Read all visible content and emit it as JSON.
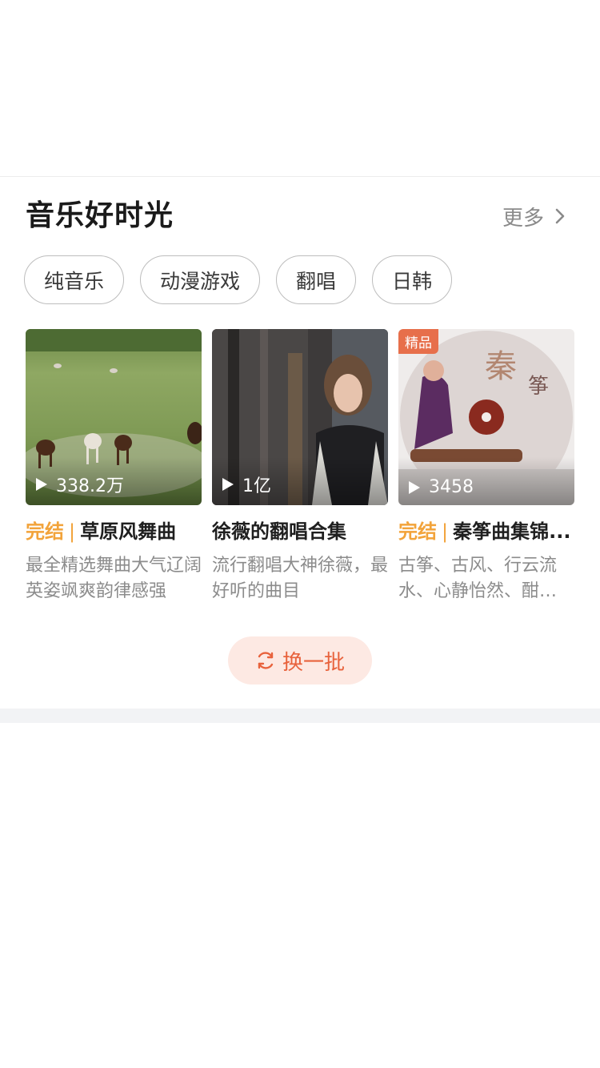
{
  "section": {
    "title": "音乐好时光",
    "more_label": "更多"
  },
  "tags": [
    "纯音乐",
    "动漫游戏",
    "翻唱",
    "日韩"
  ],
  "cards": [
    {
      "status": "完结",
      "title": "草原风舞曲",
      "play_count": "338.2万",
      "description": "最全精选舞曲大气辽阔英姿飒爽韵律感强",
      "image": "horses-on-grassland"
    },
    {
      "title": "徐薇的翻唱合集",
      "play_count": "1亿",
      "description": "流行翻唱大神徐薇，最好听的曲目",
      "image": "woman-with-guitars"
    },
    {
      "badge": "精品",
      "status": "完结",
      "title": "秦筝曲集锦...",
      "play_count": "3458",
      "description": "古筝、古风、行云流水、心静怡然、酣…",
      "image": "guzheng-album-disc"
    }
  ],
  "refresh_label": "换一批",
  "colors": {
    "accent": "#e8623c",
    "status": "#f2a33a",
    "badge": "#e76f4b"
  }
}
